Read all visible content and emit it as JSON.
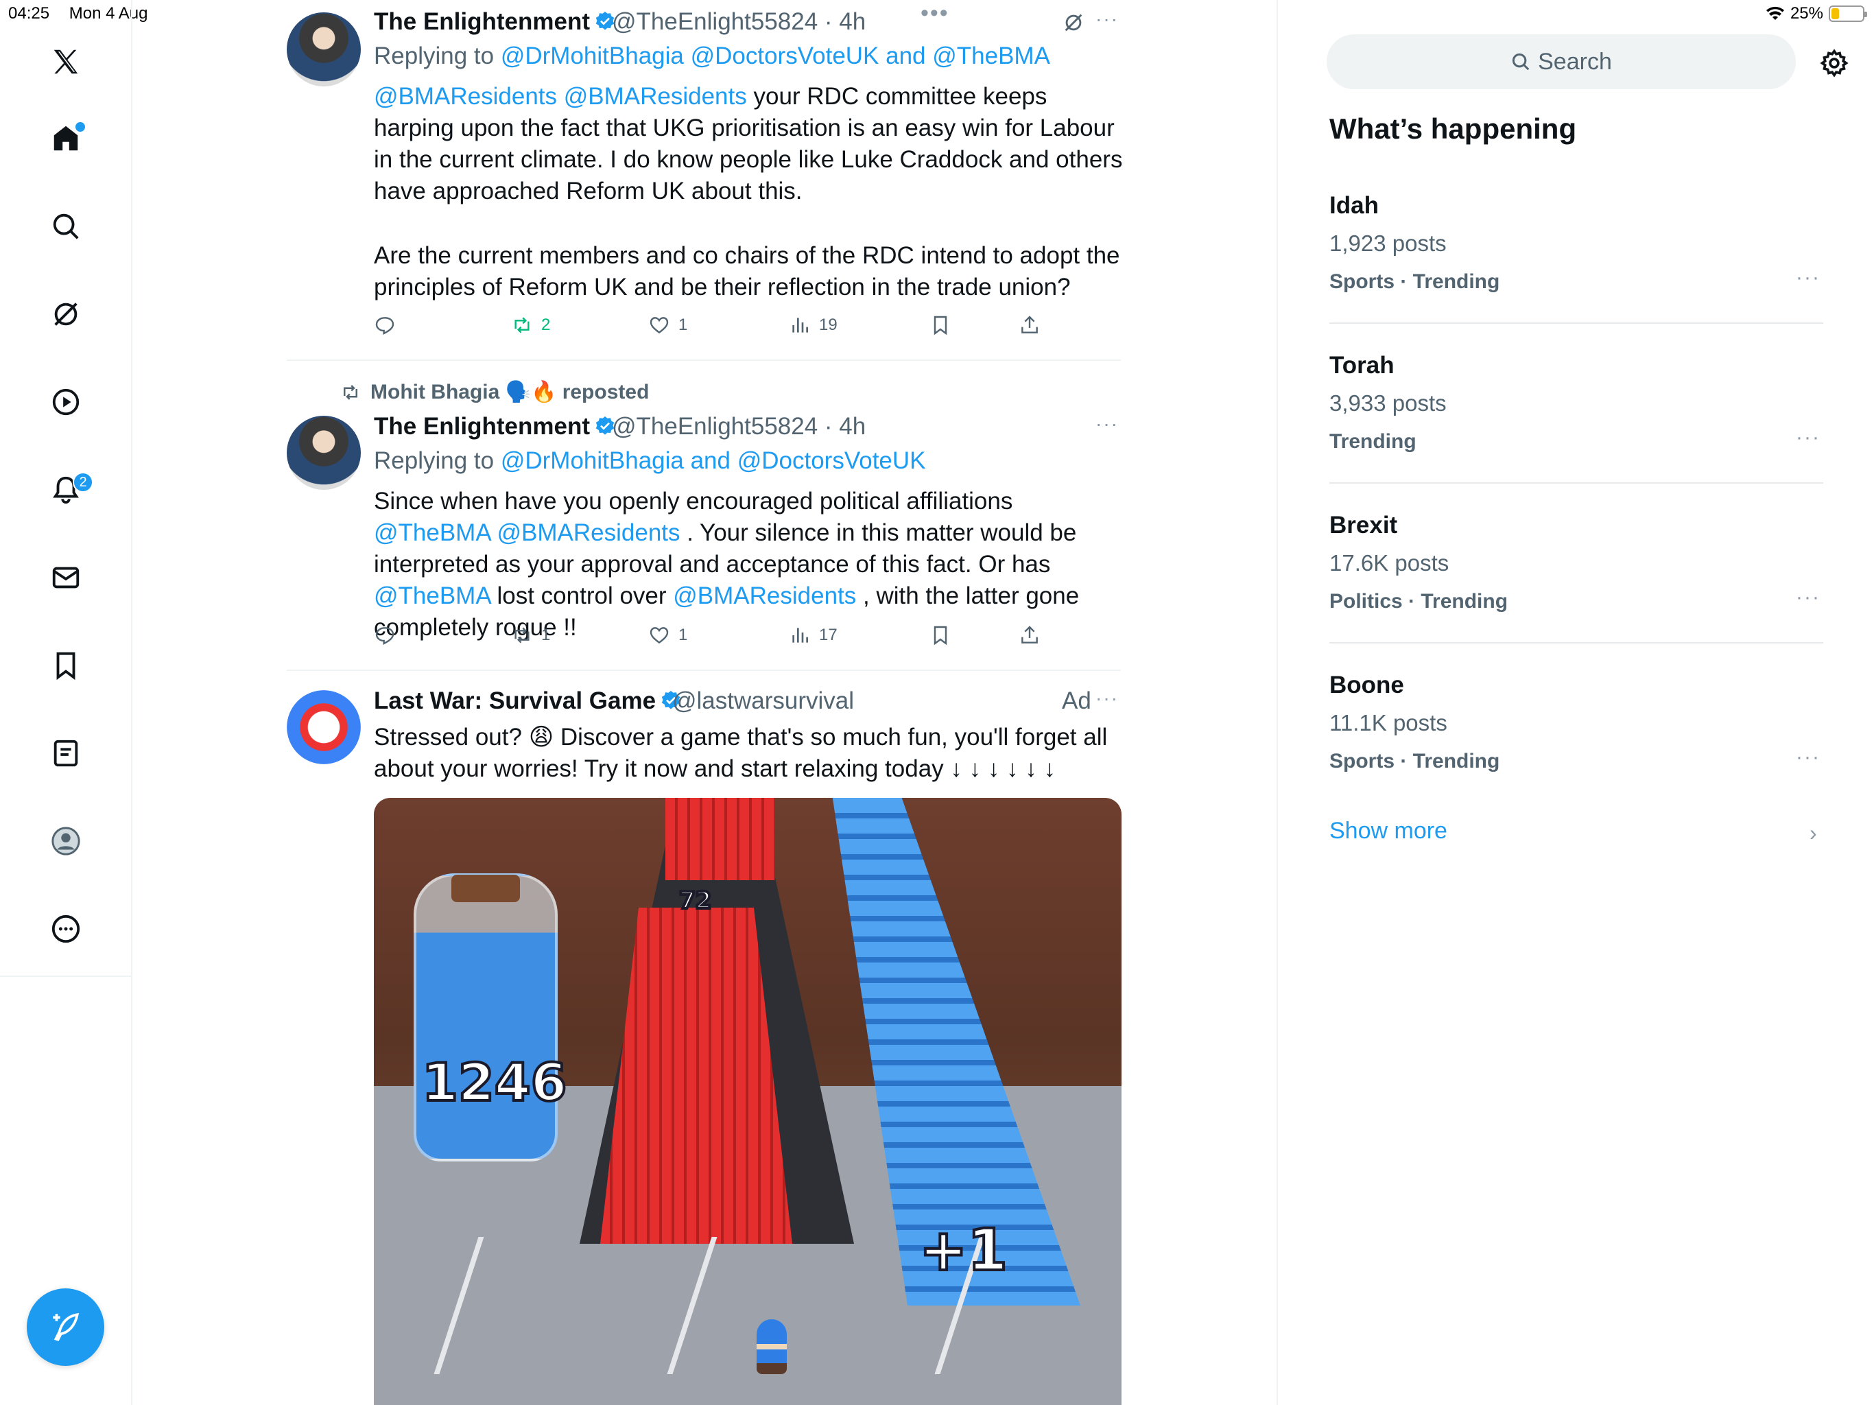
{
  "status_bar": {
    "time": "04:25",
    "date": "Mon 4 Aug",
    "battery": "25%"
  },
  "nav": {
    "notifications_badge": "2",
    "items": [
      "x-logo",
      "home",
      "explore",
      "grok",
      "video",
      "notifications",
      "messages",
      "bookmarks",
      "lists",
      "profile",
      "more"
    ]
  },
  "tweets": [
    {
      "name": "The Enlightenment",
      "handle": "@TheEnlight55824 · 4h",
      "reply_prefix": "Replying to",
      "reply_to": "@DrMohitBhagia @DoctorsVoteUK and @TheBMA",
      "text_link1": "@BMAResidents @BMAResidents",
      "text_body": " your RDC committee keeps harping upon the fact that UKG prioritisation is an easy win for Labour in the current climate. I do know people like Luke Craddock and others have approached Reform UK about this.",
      "text_p2": "Are the current members and co chairs of the RDC intend to adopt the principles of Reform UK and be their reflection in the trade union?",
      "replies": "",
      "reposts": "2",
      "likes": "1",
      "views": "19"
    },
    {
      "reposted_by": "Mohit Bhagia 🗣️🔥 reposted",
      "name": "The Enlightenment",
      "handle": "@TheEnlight55824 · 4h",
      "reply_prefix": "Replying to",
      "reply_to": "@DrMohitBhagia and @DoctorsVoteUK",
      "seg1": "Since when have you openly encouraged political affiliations ",
      "link1": "@TheBMA",
      "link2": "@BMAResidents",
      "seg2": " . Your silence in this matter would be interpreted as your approval and acceptance of this fact. Or has ",
      "link3": "@TheBMA",
      "seg3": " lost control over ",
      "link4": "@BMAResidents",
      "seg4": " , with the latter gone completely rogue !!",
      "replies": "",
      "reposts": "1",
      "likes": "1",
      "views": "17"
    },
    {
      "name": "Last War: Survival Game",
      "handle": "@lastwarsurvival",
      "ad_label": "Ad",
      "text": "Stressed out? 😩 Discover a game that's so much fun, you'll forget all about your worries! Try it now and start relaxing today ↓ ↓ ↓ ↓ ↓ ↓",
      "media_numbers": [
        "1246",
        "72",
        "+1"
      ]
    }
  ],
  "sidebar": {
    "search_placeholder": "Search",
    "section_title": "What’s happening",
    "trends": [
      {
        "name": "Idah",
        "posts": "1,923 posts",
        "category": "Sports · Trending"
      },
      {
        "name": "Torah",
        "posts": "3,933 posts",
        "category": "Trending"
      },
      {
        "name": "Brexit",
        "posts": "17.6K posts",
        "category": "Politics · Trending"
      },
      {
        "name": "Boone",
        "posts": "11.1K posts",
        "category": "Sports · Trending"
      }
    ],
    "show_more": "Show more"
  },
  "colors": {
    "accent": "#1d9bf0",
    "repost_green": "#00ba7c",
    "text": "#0f1419",
    "muted": "#536471"
  }
}
